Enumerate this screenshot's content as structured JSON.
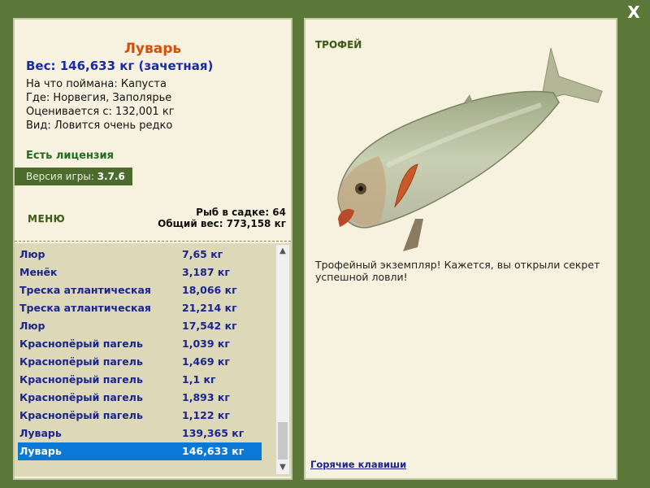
{
  "close_label": "X",
  "fish": {
    "title": "Луварь",
    "weight": "Вес: 146,633 кг (зачетная)",
    "caught_with": "На что поймана: Капуста",
    "location": "Где: Норвегия, Заполярье",
    "valued_from": "Оценивается с: 132,001 кг",
    "rarity": "Вид: Ловится очень редко"
  },
  "license": "Есть лицензия",
  "version": {
    "label": "Версия игры:",
    "value": "3.7.6"
  },
  "menu_label": "МЕНЮ",
  "stats": {
    "fish_count": "Рыб в садке: 64",
    "total_weight": "Общий вес: 773,158 кг"
  },
  "catch_list": [
    {
      "name": "Люр",
      "weight": "7,65 кг"
    },
    {
      "name": "Менёк",
      "weight": "3,187 кг"
    },
    {
      "name": "Треска атлантическая",
      "weight": "18,066 кг"
    },
    {
      "name": "Треска атлантическая",
      "weight": "21,214 кг"
    },
    {
      "name": "Люр",
      "weight": "17,542 кг"
    },
    {
      "name": "Краснопёрый пагель",
      "weight": "1,039 кг"
    },
    {
      "name": "Краснопёрый пагель",
      "weight": "1,469 кг"
    },
    {
      "name": "Краснопёрый пагель",
      "weight": "1,1 кг"
    },
    {
      "name": "Краснопёрый пагель",
      "weight": "1,893 кг"
    },
    {
      "name": "Краснопёрый пагель",
      "weight": "1,122 кг"
    },
    {
      "name": "Луварь",
      "weight": "139,365 кг"
    },
    {
      "name": "Луварь",
      "weight": "146,633 кг",
      "selected": true
    }
  ],
  "trophy": {
    "label": "ТРОФЕЙ",
    "text": "Трофейный экземпляр! Кажется, вы открыли секрет успешной ловли!"
  },
  "hotkeys_label": "Горячие клавиши",
  "colors": {
    "frame": "#5b7838",
    "panel": "#f7f2df",
    "selected_row": "#0a78d7",
    "title": "#d2500b",
    "link": "#1a2590"
  },
  "icons": {
    "close": "close-icon",
    "scroll_up": "chevron-up-icon",
    "scroll_down": "chevron-down-icon"
  }
}
